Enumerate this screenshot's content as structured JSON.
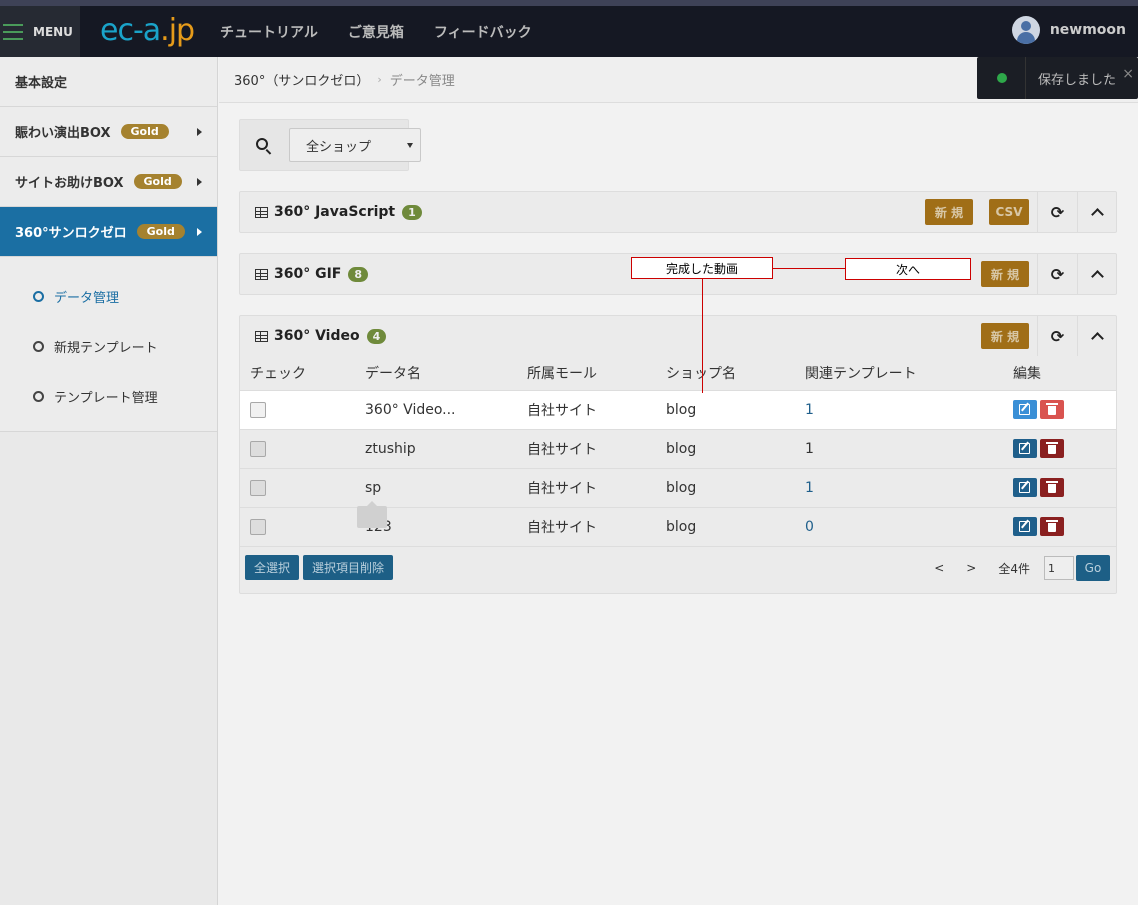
{
  "header": {
    "menu_label": "MENU",
    "logo_main": "ec-a",
    "logo_dot": ".",
    "logo_tld": "jp",
    "nav": [
      "チュートリアル",
      "ご意見箱",
      "フィードバック"
    ],
    "username": "newmoon"
  },
  "sidebar": {
    "items": [
      {
        "label": "基本設定"
      },
      {
        "label": "賑わい演出BOX",
        "badge": "Gold"
      },
      {
        "label": "サイトお助けBOX",
        "badge": "Gold"
      },
      {
        "label": "360°サンロクゼロ",
        "badge": "Gold"
      }
    ],
    "sub_items": [
      "データ管理",
      "新規テンプレート",
      "テンプレート管理"
    ]
  },
  "breadcrumb": {
    "parent": "360°（サンロクゼロ）",
    "sep": "›",
    "current": "データ管理"
  },
  "search": {
    "selected": "全ショップ"
  },
  "panels": [
    {
      "title": "360° JavaScript",
      "count": "1",
      "new_label": "新 規",
      "csv_label": "CSV"
    },
    {
      "title": "360° GIF",
      "count": "8",
      "new_label": "新 規"
    },
    {
      "title": "360° Video",
      "count": "4",
      "new_label": "新 規"
    }
  ],
  "table": {
    "headers": [
      "チェック",
      "データ名",
      "所属モール",
      "ショップ名",
      "関連テンプレート",
      "編集"
    ],
    "rows": [
      {
        "name": "360° Video...",
        "mall": "自社サイト",
        "shop": "blog",
        "templates": "1"
      },
      {
        "name": "ztuship",
        "mall": "自社サイト",
        "shop": "blog",
        "templates": "1"
      },
      {
        "name": "sp",
        "mall": "自社サイト",
        "shop": "blog",
        "templates": "1"
      },
      {
        "name": "123",
        "mall": "自社サイト",
        "shop": "blog",
        "templates": "0"
      }
    ]
  },
  "footer": {
    "select_all": "全選択",
    "delete_selected": "選択項目削除",
    "prev": "<",
    "next": ">",
    "total": "全4件",
    "page": "1",
    "go": "Go"
  },
  "toast": {
    "message": "保存しました",
    "close": "×"
  },
  "callouts": {
    "done_video": "完成した動画",
    "next": "次へ"
  },
  "colors": {
    "accent": "#1b6fa3",
    "gold": "#a5822f",
    "annotation": "#cc0000"
  }
}
